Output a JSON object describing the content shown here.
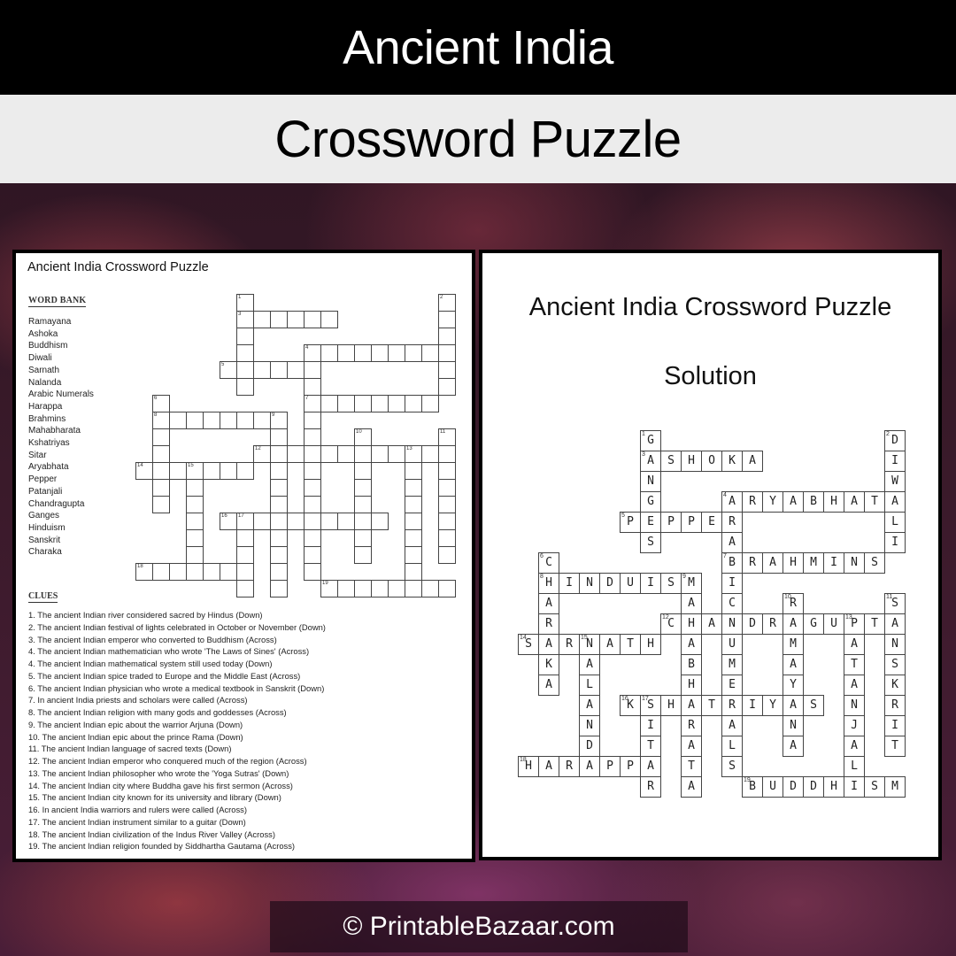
{
  "header": {
    "title": "Ancient India",
    "subtitle": "Crossword Puzzle"
  },
  "puzzle": {
    "title": "Ancient India Crossword Puzzle",
    "word_bank_title": "WORD BANK",
    "word_bank": [
      "Ramayana",
      "Ashoka",
      "Buddhism",
      "Diwali",
      "Sarnath",
      "Nalanda",
      "Arabic Numerals",
      "Harappa",
      "Brahmins",
      "Mahabharata",
      "Kshatriyas",
      "Sitar",
      "Aryabhata",
      "Pepper",
      "Patanjali",
      "Chandragupta",
      "Ganges",
      "Hinduism",
      "Sanskrit",
      "Charaka"
    ],
    "clues_title": "CLUES",
    "clues": [
      "1. The ancient Indian river considered sacred by Hindus (Down)",
      "2. The ancient Indian festival of lights celebrated in October or November  (Down)",
      "3. The ancient Indian emperor  who converted to Buddhism (Across)",
      "4. The ancient Indian mathematician who wrote 'The Laws of Sines' (Across)",
      "4. The ancient Indian mathematical system still used today (Down)",
      "5. The ancient Indian spice traded to Europe and the Middle East (Across)",
      "6. The ancient Indian physician who wrote a medical textbook in Sanskrit (Down)",
      "7. In ancient India priests and scholars were called (Across)",
      "8. The ancient Indian religion with many gods and goddesses (Across)",
      "9. The ancient Indian epic about the warrior Arjuna (Down)",
      "10. The ancient Indian epic about the prince  Rama (Down)",
      "11. The ancient Indian language of sacred texts (Down)",
      "12. The ancient Indian emperor  who conquered much of the region (Across)",
      "13. The ancient Indian philosopher who wrote the 'Yoga Sutras' (Down)",
      "14. The ancient Indian city where  Buddha gave his first sermon  (Across)",
      "15. The ancient Indian city known  for its university and library (Down)",
      "16. In ancient India warriors  and rulers were called (Across)",
      "17. The ancient Indian instrument  similar to a guitar (Down)",
      "18. The ancient Indian civilization of the  Indus River Valley (Across)",
      "19. The ancient Indian religion founded by Siddhartha  Gautama (Across)"
    ],
    "entries": [
      {
        "num": 1,
        "dir": "down",
        "row": 0,
        "col": 6,
        "answer": "GANGES"
      },
      {
        "num": 2,
        "dir": "down",
        "row": 0,
        "col": 18,
        "answer": "DIWALI"
      },
      {
        "num": 3,
        "dir": "across",
        "row": 1,
        "col": 6,
        "answer": "ASHOKA"
      },
      {
        "num": 4,
        "dir": "across",
        "row": 3,
        "col": 10,
        "answer": "ARYABHATA"
      },
      {
        "num": 4,
        "dir": "down",
        "row": 3,
        "col": 10,
        "answer": "ARABICNUMERALS"
      },
      {
        "num": 5,
        "dir": "across",
        "row": 4,
        "col": 5,
        "answer": "PEPPER"
      },
      {
        "num": 6,
        "dir": "down",
        "row": 6,
        "col": 1,
        "answer": "CHARAKA"
      },
      {
        "num": 7,
        "dir": "across",
        "row": 6,
        "col": 10,
        "answer": "BRAHMINS"
      },
      {
        "num": 8,
        "dir": "across",
        "row": 7,
        "col": 1,
        "answer": "HINDUISM"
      },
      {
        "num": 9,
        "dir": "down",
        "row": 7,
        "col": 8,
        "answer": "MAHABHARATA"
      },
      {
        "num": 10,
        "dir": "down",
        "row": 8,
        "col": 13,
        "answer": "RAMAYANA"
      },
      {
        "num": 11,
        "dir": "down",
        "row": 8,
        "col": 18,
        "answer": "SANSKRIT"
      },
      {
        "num": 12,
        "dir": "across",
        "row": 9,
        "col": 7,
        "answer": "CHANDRAGUPTA"
      },
      {
        "num": 13,
        "dir": "down",
        "row": 9,
        "col": 16,
        "answer": "PATANJALI"
      },
      {
        "num": 14,
        "dir": "across",
        "row": 10,
        "col": 0,
        "answer": "SARNATH"
      },
      {
        "num": 15,
        "dir": "down",
        "row": 10,
        "col": 3,
        "answer": "NALANDA"
      },
      {
        "num": 16,
        "dir": "across",
        "row": 13,
        "col": 5,
        "answer": "KSHATRIYAS"
      },
      {
        "num": 17,
        "dir": "down",
        "row": 13,
        "col": 6,
        "answer": "SITAR"
      },
      {
        "num": 18,
        "dir": "across",
        "row": 16,
        "col": 0,
        "answer": "HARAPPA"
      },
      {
        "num": 19,
        "dir": "across",
        "row": 17,
        "col": 11,
        "answer": "BUDDHISM"
      }
    ]
  },
  "solution": {
    "title": "Ancient India Crossword Puzzle",
    "subtitle": "Solution"
  },
  "footer": {
    "copyright": "© PrintableBazaar.com"
  }
}
